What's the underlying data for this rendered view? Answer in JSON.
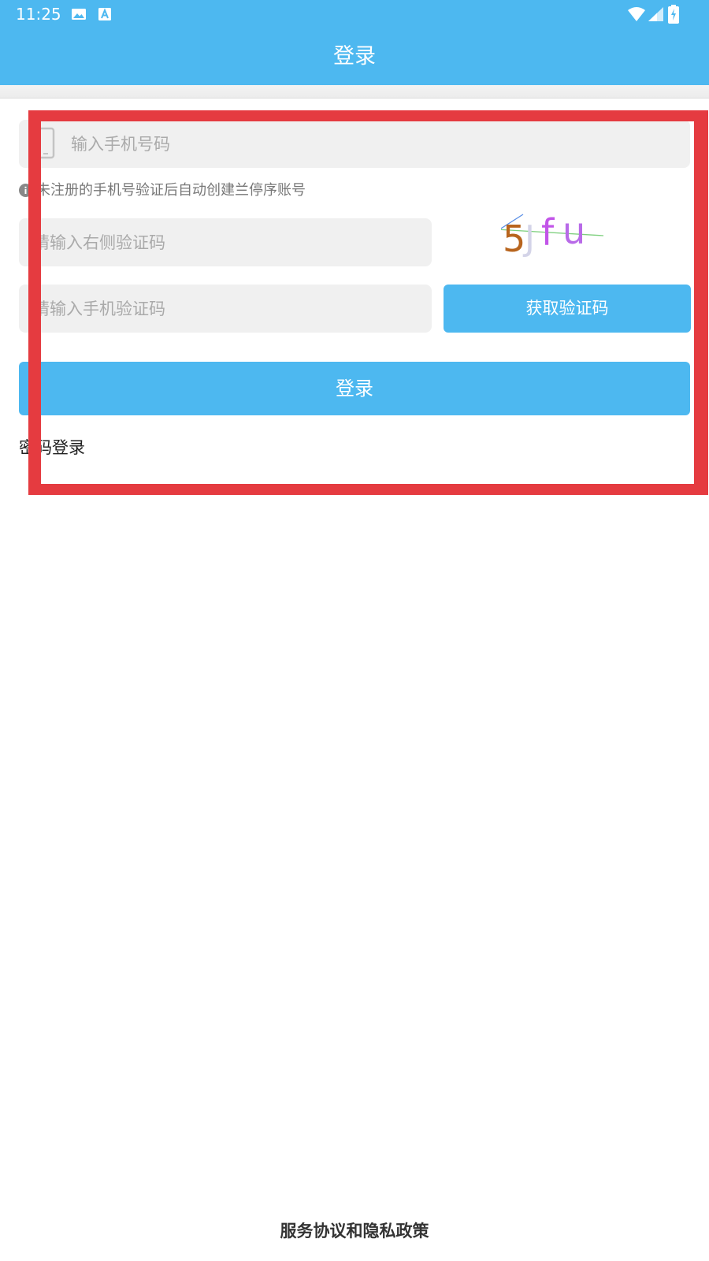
{
  "status_bar": {
    "time": "11:25",
    "left_icons": [
      "image-icon",
      "a-badge-icon"
    ],
    "right_icons": [
      "wifi-icon",
      "signal-icon",
      "battery-charging-icon"
    ]
  },
  "app_bar": {
    "title": "登录",
    "color": "#4db8f0"
  },
  "form": {
    "phone_placeholder": "输入手机号码",
    "hint_text": "未注册的手机号验证后自动创建兰停序账号",
    "captcha_placeholder": "请输入右侧验证码",
    "captcha_image_text": "5Jfu",
    "sms_placeholder": "请输入手机验证码",
    "get_code_label": "获取验证码",
    "login_label": "登录",
    "password_login_label": "密码登录"
  },
  "footer": {
    "policy_label": "服务协议和隐私政策"
  },
  "colors": {
    "accent": "#4db8f0",
    "input_bg": "#f0f0f0",
    "highlight": "#e53b40"
  }
}
